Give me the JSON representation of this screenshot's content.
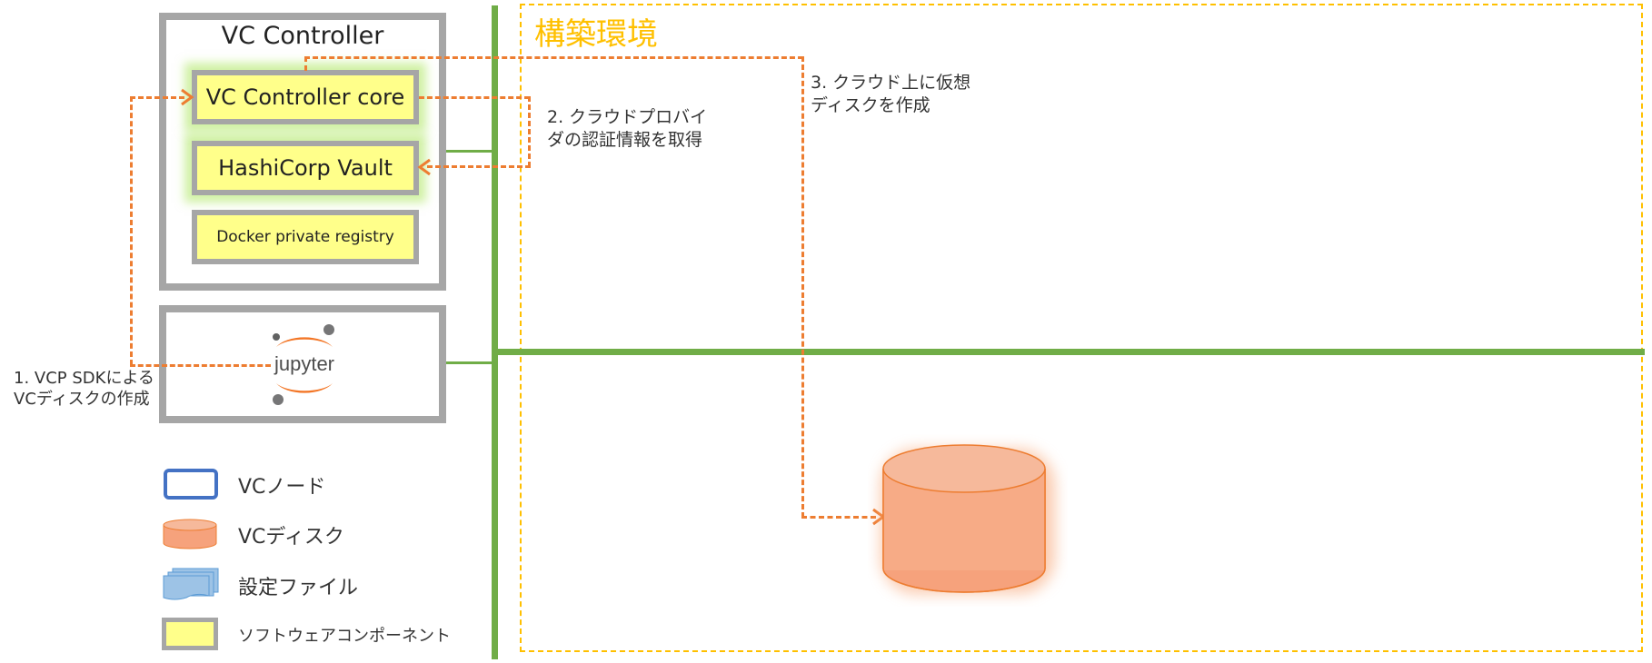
{
  "controller": {
    "title": "VC Controller",
    "core_label": "VC Controller core",
    "vault_label": "HashiCorp Vault",
    "registry_label": "Docker private registry"
  },
  "jupyter": {
    "logo_text": "jupyter"
  },
  "build_env": {
    "title": "構築環境"
  },
  "steps": {
    "step1": "1. VCP SDKによる\nVCディスクの作成",
    "step2": "2. クラウドプロバイ\nダの認証情報を取得",
    "step3": "3. クラウド上に仮想\nディスクを作成"
  },
  "legend": {
    "node": "VCノード",
    "disk": "VCディスク",
    "config": "設定ファイル",
    "software": "ソフトウェアコンポーネント"
  },
  "colors": {
    "network": "#70ad47",
    "arrow": "#ed7d31",
    "software_fill": "#ffff8a",
    "box_border": "#a6a6a6",
    "env_border": "#ffc000",
    "env_title": "#ffc000",
    "node_border": "#4472c4"
  }
}
